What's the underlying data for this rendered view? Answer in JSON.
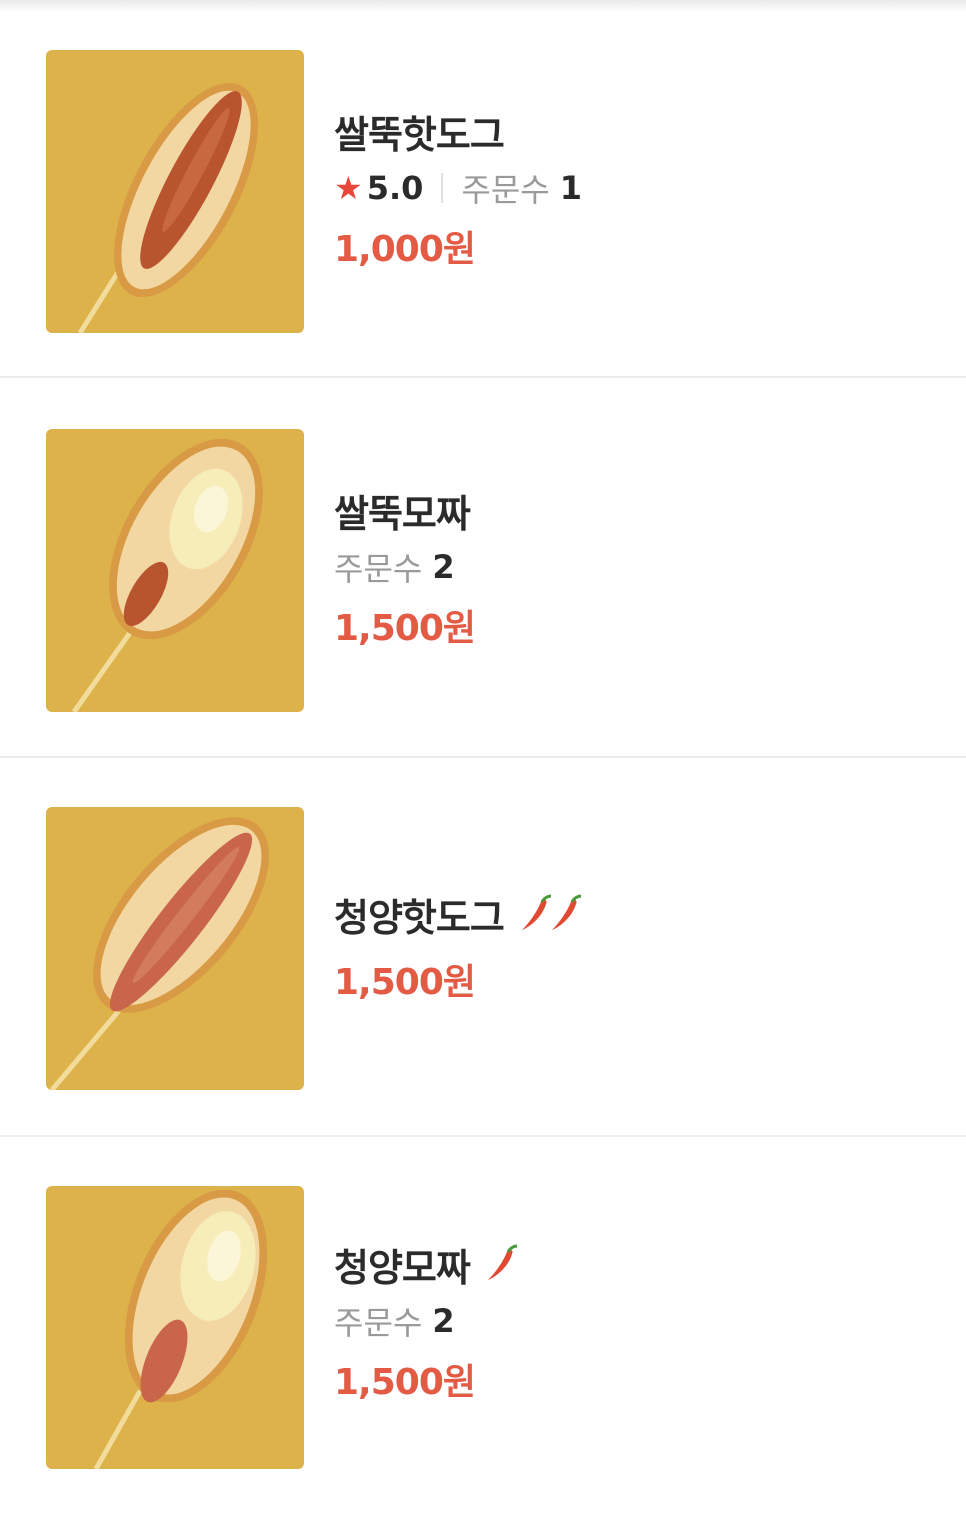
{
  "items": [
    {
      "name": "쌀뚝핫도그",
      "rating": "5.0",
      "orders_label": "주문수",
      "orders": "1",
      "price": "1,000원",
      "spicy": 0,
      "photo": "hotdog-icon"
    },
    {
      "name": "쌀뚝모짜",
      "orders_label": "주문수",
      "orders": "2",
      "price": "1,500원",
      "spicy": 0,
      "photo": "mozzarella-hotdog-icon"
    },
    {
      "name": "청양핫도그",
      "price": "1,500원",
      "spicy": 2,
      "photo": "hotdog-icon"
    },
    {
      "name": "청양모짜",
      "orders_label": "주문수",
      "orders": "2",
      "price": "1,500원",
      "spicy": 1,
      "photo": "mozzarella-hotdog-icon"
    }
  ],
  "colors": {
    "price": "#e35b45",
    "star": "#e9473a",
    "thumb_bg": "#ddb24a",
    "pepper": "#e04a32"
  },
  "icons": {
    "star": "star-icon",
    "pepper": "chili-pepper-icon"
  }
}
